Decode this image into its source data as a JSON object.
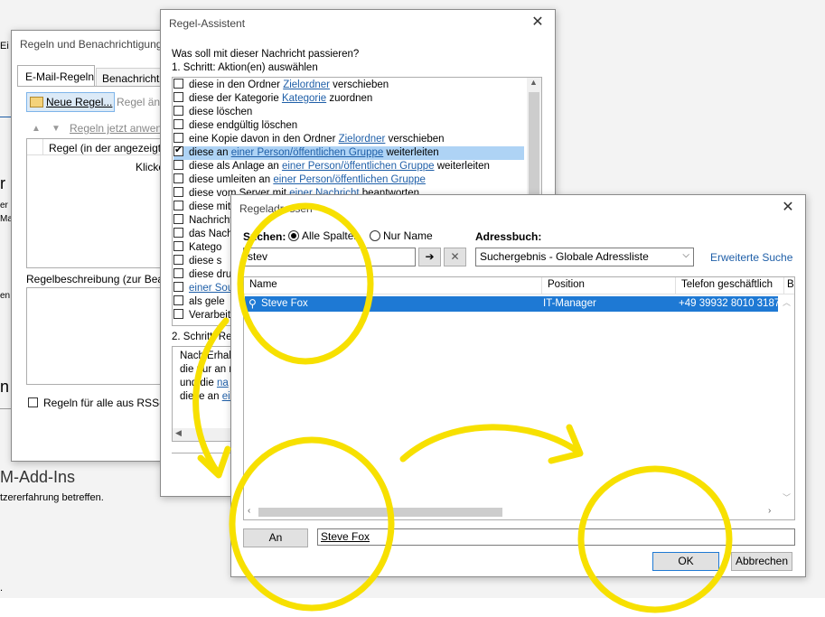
{
  "background": {
    "frag_ei": "Ei",
    "frag_r": "r",
    "frag_er": "er",
    "frag_ma": "Mai",
    "frag_en": "en",
    "frag_n": "n",
    "com_addins": "M-Add-Ins",
    "com_desc": "tzererfahrung betreffen.",
    "frag_dot": "."
  },
  "rules_window": {
    "title": "Regeln und Benachrichtigung",
    "tab_email": "E-Mail-Regeln",
    "tab_notify": "Benachrichtig",
    "new_rule": "Neue Regel...",
    "change_rule": "Regel änd",
    "apply_now": "Regeln jetzt anwen",
    "col_rule": "Regel (in der angezeigt",
    "click_hint": "Klicke",
    "desc_label": "Regelbeschreibung (zur Bear",
    "rss_label": "Regeln für alle aus RSS-Fe"
  },
  "wizard": {
    "title": "Regel-Assistent",
    "question": "Was soll mit dieser Nachricht passieren?",
    "step1": "1. Schritt: Aktion(en) auswählen",
    "rows": [
      {
        "pre": "diese in den Ordner ",
        "link": "Zielordner",
        "post": " verschieben",
        "checked": false,
        "selected": false
      },
      {
        "pre": "diese der Kategorie ",
        "link": "Kategorie",
        "post": " zuordnen",
        "checked": false,
        "selected": false
      },
      {
        "pre": "diese löschen",
        "link": "",
        "post": "",
        "checked": false,
        "selected": false
      },
      {
        "pre": "diese endgültig löschen",
        "link": "",
        "post": "",
        "checked": false,
        "selected": false
      },
      {
        "pre": "eine Kopie davon in den Ordner ",
        "link": "Zielordner",
        "post": " verschieben",
        "checked": false,
        "selected": false
      },
      {
        "pre": "diese an ",
        "link": "einer Person/öffentlichen Gruppe",
        "post": " weiterleiten",
        "checked": true,
        "selected": true
      },
      {
        "pre": "diese als Anlage an ",
        "link": "einer Person/öffentlichen Gruppe",
        "post": " weiterleiten",
        "checked": false,
        "selected": false
      },
      {
        "pre": "diese umleiten an ",
        "link": "einer Person/öffentlichen Gruppe",
        "post": "",
        "checked": false,
        "selected": false
      },
      {
        "pre": "diese vom Server mit ",
        "link": "einer Nachricht",
        "post": " beantworten",
        "checked": false,
        "selected": false
      },
      {
        "pre": "diese mit",
        "link": "",
        "post": "",
        "checked": false,
        "selected": false
      },
      {
        "pre": "Nachricht",
        "link": "",
        "post": "",
        "checked": false,
        "selected": false
      },
      {
        "pre": "das Nach",
        "link": "",
        "post": "",
        "checked": false,
        "selected": false
      },
      {
        "pre": "Katego",
        "link": "",
        "post": "",
        "checked": false,
        "selected": false
      },
      {
        "pre": "diese s",
        "link": "",
        "post": "",
        "checked": false,
        "selected": false
      },
      {
        "pre": "diese dru",
        "link": "",
        "post": "",
        "checked": false,
        "selected": false
      },
      {
        "pre": "",
        "link": "einer Sou",
        "post": "",
        "checked": false,
        "selected": false
      },
      {
        "pre": "als gele",
        "link": "",
        "post": "",
        "checked": false,
        "selected": false
      },
      {
        "pre": "Verarbeit",
        "link": "",
        "post": "",
        "checked": false,
        "selected": false
      }
    ],
    "step2": "2. Schritt: Reg",
    "desc_lines": [
      {
        "pre": "Nach Erhalt",
        "link": ""
      },
      {
        "pre": "die nur an n",
        "link": ""
      },
      {
        "pre": "und die ",
        "link": "na"
      },
      {
        "pre": "diese an ",
        "link": "ein"
      }
    ]
  },
  "address_dialog": {
    "title": "Regeladressen",
    "search_label": "Suchen:",
    "radio_all": "Alle Spalten",
    "radio_name": "Nur Name",
    "addressbook_label": "Adressbuch:",
    "search_value": "stev",
    "arrow_btn": "➔",
    "clear_btn": "✕",
    "addressbook_value": "Suchergebnis - Globale Adressliste",
    "advanced_search": "Erweiterte Suche",
    "columns": [
      "Name",
      "Position",
      "Telefon geschäftlich",
      "B"
    ],
    "result": {
      "name": "Steve Fox",
      "position": "IT-Manager",
      "phone": "+49 39932 8010 3187"
    },
    "to_button": "An",
    "to_value": "Steve Fox",
    "ok": "OK",
    "cancel": "Abbrechen"
  },
  "annotation_color": "#f7e000"
}
